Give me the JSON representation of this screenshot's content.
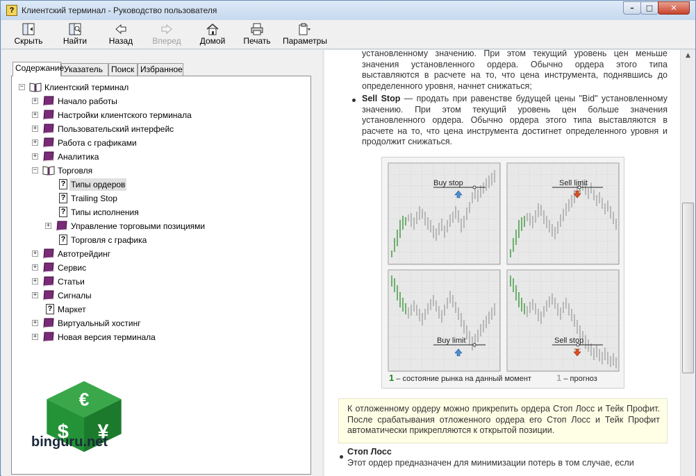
{
  "window": {
    "title": "Клиентский терминал - Руководство пользователя"
  },
  "toolbar": {
    "hide": "Скрыть",
    "find": "Найти",
    "back": "Назад",
    "forward": "Вперед",
    "home": "Домой",
    "print": "Печать",
    "options": "Параметры"
  },
  "tabs": [
    "Содержание",
    "Указатель",
    "Поиск",
    "Избранное"
  ],
  "tree": {
    "root": "Клиентский терминал",
    "items": [
      "Начало работы",
      "Настройки клиентского терминала",
      "Пользовательский интерфейс",
      "Работа с графиками",
      "Аналитика",
      "Торговля",
      "Типы ордеров",
      "Trailing Stop",
      "Типы исполнения",
      "Управление торговыми позициями",
      "Торговля с графика",
      "Автотрейдинг",
      "Сервис",
      "Статьи",
      "Сигналы",
      "Маркет",
      "Виртуальный хостинг",
      "Новая версия терминала"
    ]
  },
  "logo": {
    "text": "binguru.net"
  },
  "content": {
    "para_top": "установленному значению. При этом текущий уровень цен меньше значения установленного ордера. Обычно ордера этого типа выставляются в расчете на то, что цена инструмента, поднявшись до определенного уровня, начнет снижаться;",
    "sell_stop_term": "Sell Stop",
    "sell_stop_text": " — продать при равенстве будущей цены \"Bid\" установленному значению. При этом текущий уровень цен больше значения установленного ордера. Обычно ордера этого типа выставляются в расчете на то, что цена инструмента достигнет определенного уровня и продолжит снижаться.",
    "figure": {
      "labels": [
        "Buy stop",
        "Sell limit",
        "Buy limit",
        "Sell stop"
      ],
      "legend_1_num": "1",
      "legend_1": " – состояние рынка на данный момент",
      "legend_2_num": "1",
      "legend_2": " – прогноз"
    },
    "note": "К отложенному ордеру можно прикрепить ордера Стоп Лосс и Тейк Профит. После срабатывания отложенного ордера его Стоп Лосс и Тейк Профит автоматически прикрепляются к открытой позиции.",
    "stop_loss_term": "Стоп Лосс",
    "stop_loss_text": "Этот ордер предназначен для минимизации потерь в том случае, если"
  }
}
